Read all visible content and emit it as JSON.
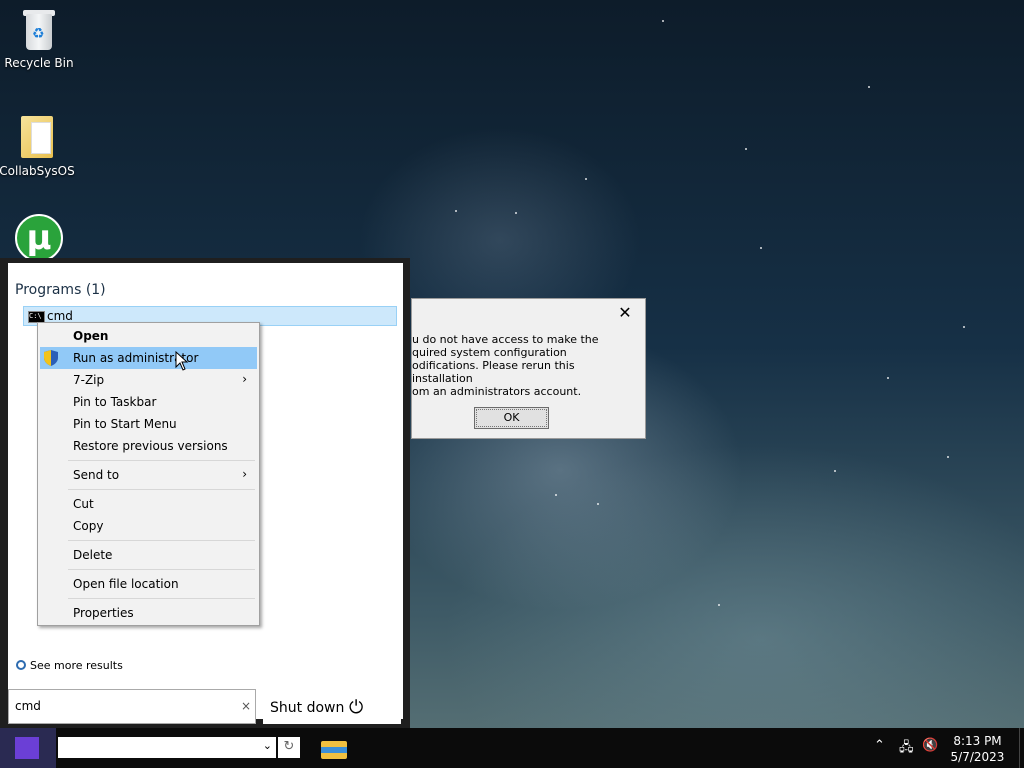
{
  "desktop": {
    "icons": [
      {
        "label": "Recycle Bin",
        "icon": "recycle-bin-icon"
      },
      {
        "label": "CollabSysOS",
        "icon": "folder-icon"
      },
      {
        "label": "",
        "icon": "utorrent-icon"
      }
    ]
  },
  "dialog": {
    "close_label": "✕",
    "message": "u do not have access to make the\nquired system configuration\nodifications. Please rerun this installation\nom an administrators account.",
    "ok_label": "OK"
  },
  "start_menu": {
    "programs_heading": "Programs (1)",
    "program_name": "cmd",
    "see_more": "See more results",
    "search_value": "cmd",
    "search_clear": "×",
    "shutdown_label": "Shut down"
  },
  "context_menu": {
    "items": [
      {
        "label": "Open",
        "bold": true
      },
      {
        "label": "Run as administrator",
        "highlighted": true,
        "icon": "uac-shield-icon"
      },
      {
        "label": "7-Zip",
        "submenu": true
      },
      {
        "label": "Pin to Taskbar"
      },
      {
        "label": "Pin to Start Menu"
      },
      {
        "label": "Restore previous versions"
      },
      {
        "label": "Send to",
        "submenu": true
      },
      {
        "label": "Cut"
      },
      {
        "label": "Copy"
      },
      {
        "label": "Delete"
      },
      {
        "label": "Open file location"
      },
      {
        "label": "Properties"
      }
    ]
  },
  "taskbar": {
    "clock_time": "8:13 PM",
    "clock_date": "5/7/2023",
    "tray_icons": [
      "chevron-up-icon",
      "network-icon",
      "volume-muted-icon"
    ]
  },
  "colors": {
    "highlight": "#91c9f7",
    "program_row": "#cde8fb",
    "start_logo": "#6b3fd6"
  }
}
